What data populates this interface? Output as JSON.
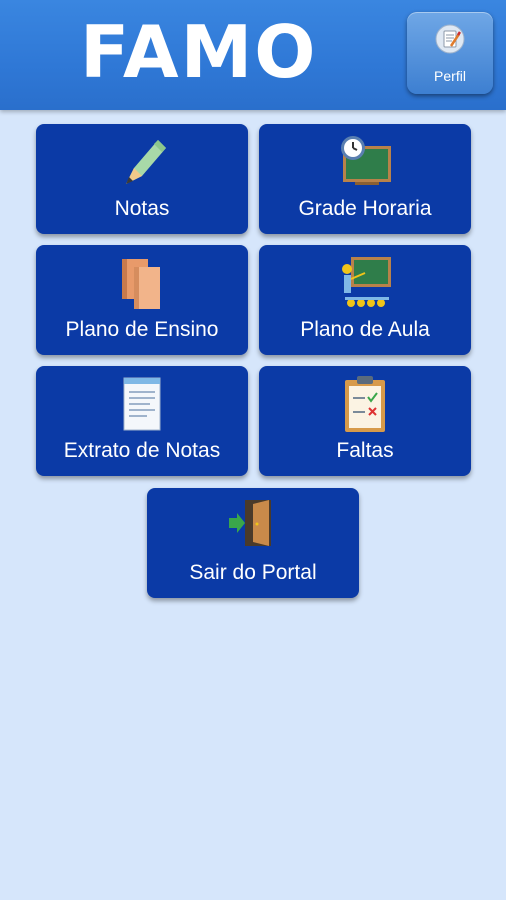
{
  "header": {
    "logo_text": "FAMO",
    "profile_label": "Perfil"
  },
  "menu": {
    "notas": {
      "label": "Notas",
      "icon": "pencil-icon"
    },
    "grade_horaria": {
      "label": "Grade Horaria",
      "icon": "clock-chalkboard-icon"
    },
    "plano_ensino": {
      "label": "Plano de Ensino",
      "icon": "books-icon"
    },
    "plano_aula": {
      "label": "Plano de Aula",
      "icon": "classroom-icon"
    },
    "extrato_notas": {
      "label": "Extrato de Notas",
      "icon": "document-icon"
    },
    "faltas": {
      "label": "Faltas",
      "icon": "clipboard-checklist-icon"
    },
    "sair": {
      "label": "Sair do Portal",
      "icon": "exit-door-icon"
    }
  },
  "colors": {
    "background": "#d6e6fb",
    "header": "#2f78d6",
    "tile": "#0b3aa6"
  }
}
